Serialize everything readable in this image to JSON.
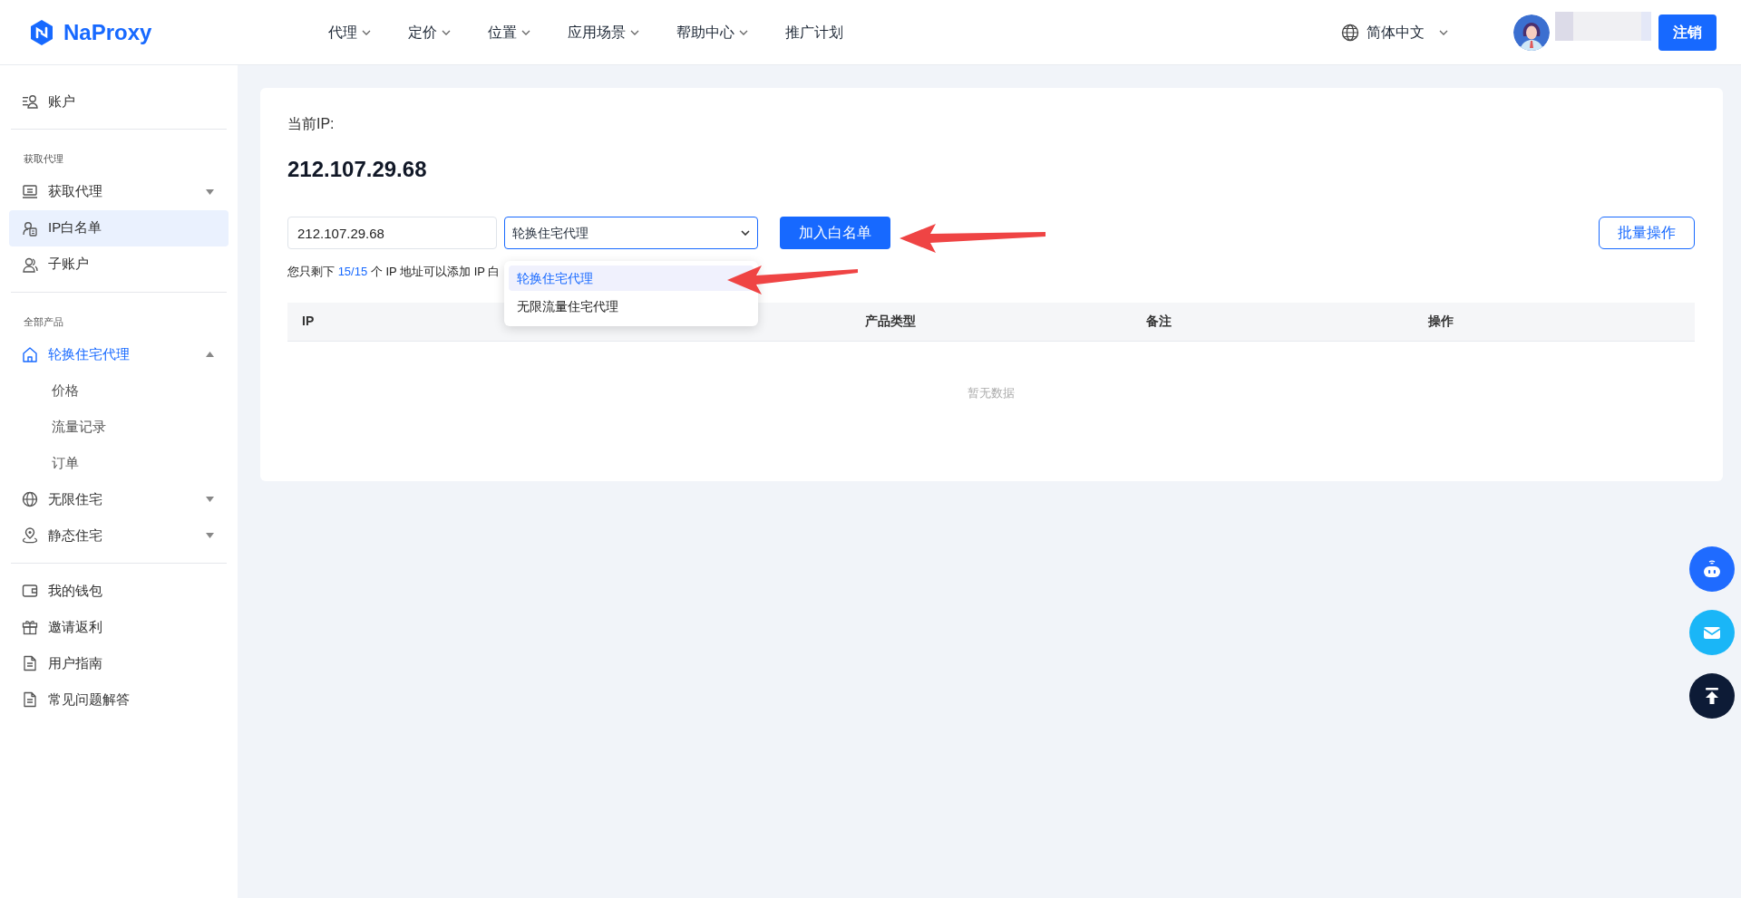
{
  "header": {
    "logo": "NaProxy",
    "nav": [
      {
        "label": "代理",
        "dropdown": true
      },
      {
        "label": "定价",
        "dropdown": true
      },
      {
        "label": "位置",
        "dropdown": true
      },
      {
        "label": "应用场景",
        "dropdown": true
      },
      {
        "label": "帮助中心",
        "dropdown": true
      },
      {
        "label": "推广计划",
        "dropdown": false
      }
    ],
    "language": {
      "label": "简体中文",
      "dropdown": true
    },
    "logout_button": "注销"
  },
  "sidebar": {
    "sections": [
      {
        "items": [
          {
            "label": "账户",
            "selected": false,
            "active": false
          }
        ]
      },
      {
        "heading": "获取代理",
        "items": [
          {
            "label": "获取代理",
            "selected": false,
            "active": false,
            "expanded": false
          },
          {
            "label": "IP白名单",
            "selected": true,
            "active": false
          },
          {
            "label": "子账户",
            "selected": false,
            "active": false
          }
        ]
      },
      {
        "heading": "全部产品",
        "items": [
          {
            "label": "轮换住宅代理",
            "selected": false,
            "active": true,
            "expanded": true,
            "children": [
              {
                "label": "价格",
                "selected": false
              },
              {
                "label": "流量记录",
                "selected": false
              },
              {
                "label": "订单",
                "selected": false
              }
            ]
          },
          {
            "label": "无限住宅",
            "selected": false,
            "active": false,
            "expanded": false
          },
          {
            "label": "静态住宅",
            "selected": false,
            "active": false,
            "expanded": false
          }
        ]
      },
      {
        "items": [
          {
            "label": "我的钱包",
            "selected": false,
            "active": false
          },
          {
            "label": "邀请返利",
            "selected": false,
            "active": false
          },
          {
            "label": "用户指南",
            "selected": false,
            "active": false
          },
          {
            "label": "常见问题解答",
            "selected": false,
            "active": false
          }
        ]
      }
    ]
  },
  "main": {
    "current_ip_label": "当前IP:",
    "current_ip": "212.107.29.68",
    "ip_input": {
      "value": "212.107.29.68"
    },
    "product_select": {
      "value": "轮换住宅代理",
      "expanded": true,
      "options": [
        {
          "label": "轮换住宅代理",
          "selected": true
        },
        {
          "label": "无限流量住宅代理",
          "selected": false
        }
      ]
    },
    "add_button": "加入白名单",
    "batch_button": "批量操作",
    "notice": {
      "before": "您只剩下",
      "count": "15/15",
      "after": "个 IP 地址可以添加 IP 白"
    },
    "table": {
      "columns": [
        "IP",
        "产品类型",
        "备注",
        "操作"
      ],
      "empty_text": "暂无数据"
    }
  }
}
